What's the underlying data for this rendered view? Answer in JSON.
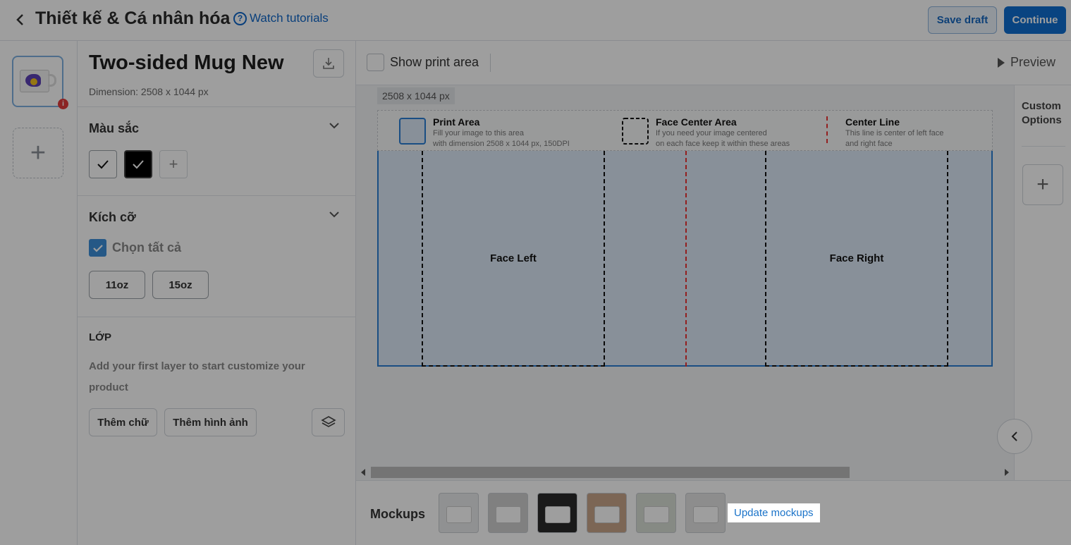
{
  "header": {
    "title": "Thiết kế & Cá nhân hóa",
    "tutorials": "Watch tutorials",
    "save_draft": "Save draft",
    "continue": "Continue"
  },
  "product": {
    "name": "Two-sided Mug New",
    "dimension": "Dimension: 2508 x 1044 px"
  },
  "colors": {
    "title": "Màu sắc",
    "swatches": [
      "#ffffff",
      "#000000"
    ]
  },
  "sizes": {
    "title": "Kích cỡ",
    "select_all": "Chọn tất cả",
    "options": [
      "11oz",
      "15oz"
    ]
  },
  "layers": {
    "title": "LỚP",
    "help": "Add your first layer to start customize your product",
    "add_text": "Thêm chữ",
    "add_image": "Thêm hình ảnh"
  },
  "toolbar": {
    "show_print_area": "Show print area",
    "preview": "Preview"
  },
  "canvas": {
    "dim_tag": "2508 x 1044 px",
    "legend": [
      {
        "title": "Print Area",
        "desc1": "Fill your image to this area",
        "desc2": "with dimension 2508 x 1044 px, 150DPI"
      },
      {
        "title": "Face Center Area",
        "desc1": "If you need your image centered",
        "desc2": "on each face keep it within these areas"
      },
      {
        "title": "Center Line",
        "desc1": "This line is center of left face",
        "desc2": "and right face"
      }
    ],
    "face_left": "Face Left",
    "face_right": "Face Right"
  },
  "mockups": {
    "label": "Mockups",
    "update": "Update mockups"
  },
  "right_panel": {
    "custom_options_1": "Custom",
    "custom_options_2": "Options"
  },
  "colors_theme": {
    "accent": "#0f6fd0",
    "print_area_fill": "#dce9f7",
    "center_line": "#e33333",
    "badge": "#e03a3a"
  }
}
